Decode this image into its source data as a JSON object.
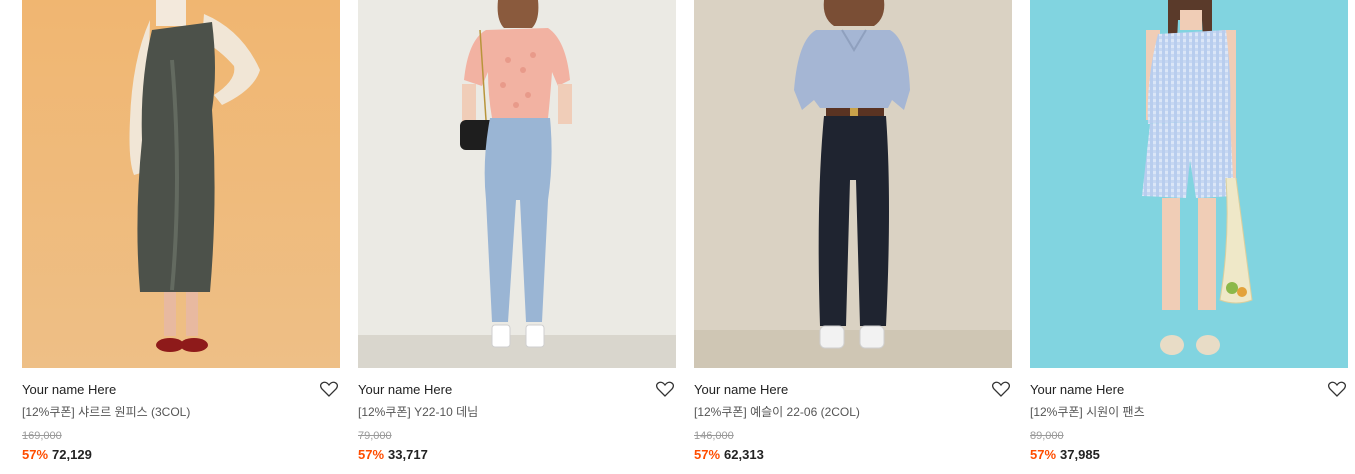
{
  "products": [
    {
      "brand": "Your name Here",
      "title": "[12%쿠폰] 샤르르 원피스 (3COL)",
      "original_price": "169,000",
      "discount": "57%",
      "price": "72,129",
      "bg_color": "#efb877"
    },
    {
      "brand": "Your name Here",
      "title": "[12%쿠폰] Y22-10 데님",
      "original_price": "79,000",
      "discount": "57%",
      "price": "33,717",
      "bg_color": "#eae9e3"
    },
    {
      "brand": "Your name Here",
      "title": "[12%쿠폰] 예슬이 22-06 (2COL)",
      "original_price": "146,000",
      "discount": "57%",
      "price": "62,313",
      "bg_color": "#d9d1c2"
    },
    {
      "brand": "Your name Here",
      "title": "[12%쿠폰] 시원이 팬츠",
      "original_price": "89,000",
      "discount": "57%",
      "price": "37,985",
      "bg_color": "#7fd3de"
    }
  ]
}
